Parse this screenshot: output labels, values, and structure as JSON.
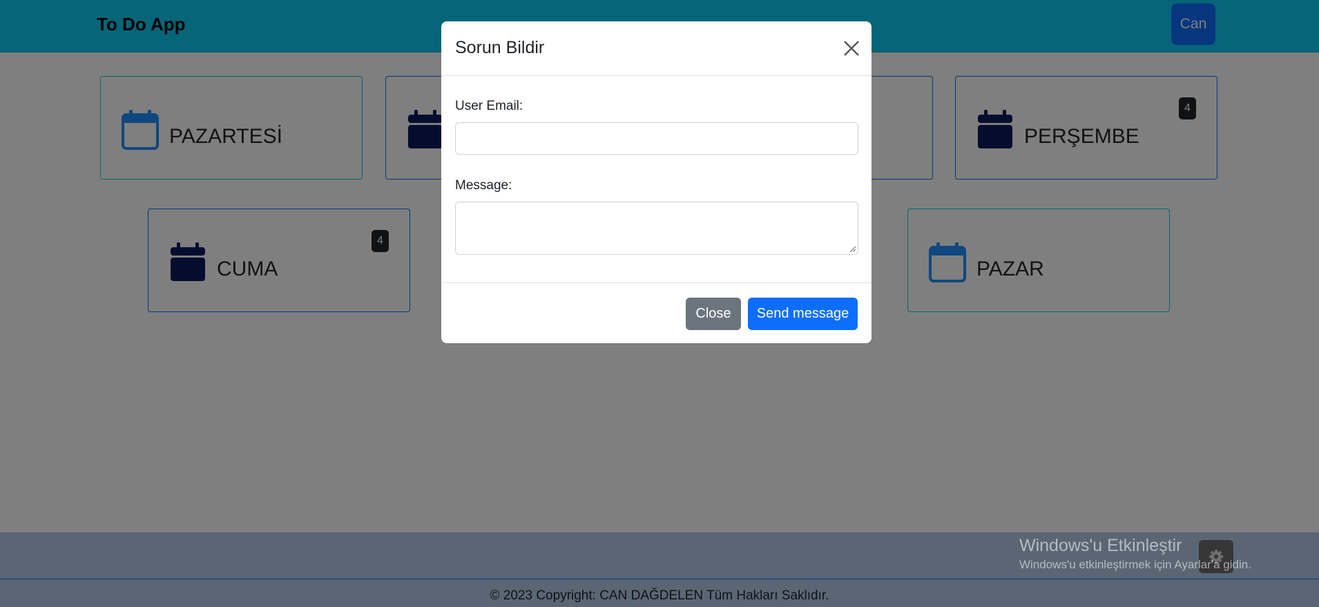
{
  "navbar": {
    "brand": "To Do App",
    "user_button": "Can"
  },
  "days": [
    {
      "name": "PAZARTESİ",
      "badge": null
    },
    {
      "name": "",
      "badge": null
    },
    {
      "name": "",
      "badge": null
    },
    {
      "name": "PERŞEMBE",
      "badge": "4"
    },
    {
      "name": "CUMA",
      "badge": "4"
    },
    {
      "name": "PAZAR",
      "badge": null
    }
  ],
  "modal": {
    "title": "Sorun Bildir",
    "email_label": "User Email:",
    "email_value": "",
    "message_label": "Message:",
    "message_value": "",
    "close_button": "Close",
    "send_button": "Send message"
  },
  "footer": {
    "copyright": "© 2023 Copyright: CAN DAĞDELEN Tüm Hakları Saklıdır."
  },
  "windows_watermark": {
    "title": "Windows'u Etkinleştir",
    "subtitle": "Windows'u etkinleştirmek için Ayarlar'a gidin."
  },
  "colors": {
    "navbar": "#0dcaf0",
    "primary": "#0d6efd",
    "calendar_dark": "#0a1a5c",
    "calendar_light": "#1e90ff",
    "secondary": "#6c757d"
  }
}
